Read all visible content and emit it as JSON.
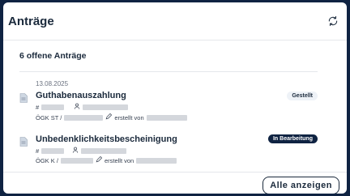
{
  "card": {
    "title": "Anträge",
    "refresh_icon": "refresh-icon",
    "count_label": "6 offene Anträge",
    "all_button": "Alle anzeigen"
  },
  "items": [
    {
      "date": "13.08.2025",
      "title": "Guthabenauszahlung",
      "id_prefix": "#",
      "org_prefix": "ÖGK ST /",
      "created_by": "erstellt von",
      "status": "Gestellt",
      "status_style": "light"
    },
    {
      "date": "",
      "title": "Unbedenklichkeitsbescheinigung",
      "id_prefix": "#",
      "org_prefix": "ÖGK K /",
      "created_by": "erstellt von",
      "status": "In Bearbeitung",
      "status_style": "dark"
    }
  ],
  "colors": {
    "navy": "#0f2342",
    "text": "#1b2a3c",
    "badge_light": "#eef2f7"
  }
}
